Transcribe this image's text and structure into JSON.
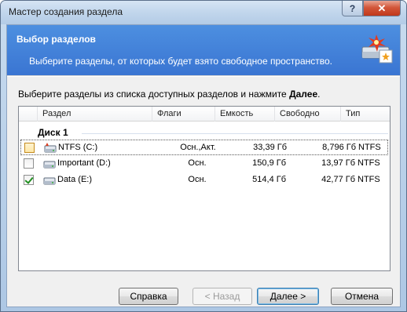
{
  "window": {
    "title": "Мастер создания раздела",
    "help_label": "?",
    "close_label": "✕"
  },
  "header": {
    "title": "Выбор разделов",
    "subtitle": "Выберите разделы, от которых будет взято свободное пространство.",
    "icon": "partition-wizard-icon"
  },
  "instruction": {
    "text": "Выберите разделы из списка доступных разделов и нажмите ",
    "emphasis": "Далее",
    "end": "."
  },
  "list": {
    "columns": [
      "Раздел",
      "Флаги",
      "Емкость",
      "Свободно",
      "Тип"
    ],
    "group": "Диск 1",
    "rows": [
      {
        "name": "NTFS (C:)",
        "flags": "Осн.,Акт.",
        "capacity": "33,39 Гб",
        "free": "8,796 Гб",
        "type": "NTFS",
        "checked": false
      },
      {
        "name": "Important (D:)",
        "flags": "Осн.",
        "capacity": "150,9 Гб",
        "free": "13,97 Гб",
        "type": "NTFS",
        "checked": false
      },
      {
        "name": "Data (E:)",
        "flags": "Осн.",
        "capacity": "514,4 Гб",
        "free": "42,77 Гб",
        "type": "NTFS",
        "checked": true
      }
    ]
  },
  "buttons": {
    "help": "Справка",
    "back": "< Назад",
    "next": "Далее >",
    "cancel": "Отмена"
  }
}
